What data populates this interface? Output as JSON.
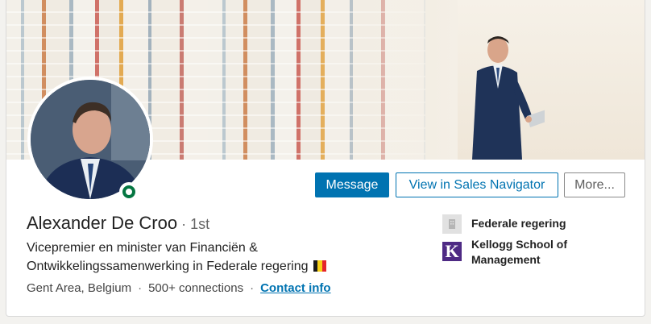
{
  "profile": {
    "name": "Alexander De Croo",
    "degree": " · 1st",
    "headline_line1": "Vicepremier en minister van Financiën &",
    "headline_line2": "Ontwikkelingssamenwerking in Federale regering",
    "location": "Gent Area, Belgium",
    "connections": "500+ connections",
    "contact_link": "Contact info",
    "separator": "·"
  },
  "actions": {
    "message": "Message",
    "sales_navigator": "View in Sales Navigator",
    "more": "More..."
  },
  "sidebar": {
    "company": "Federale regering",
    "school_line1": "Kellogg School of",
    "school_line2": "Management",
    "school_logo_letter": "K"
  },
  "icons": [
    "building-icon",
    "kellogg-logo",
    "belgium-flag-icon",
    "online-status-icon"
  ],
  "colors": {
    "primary": "#0073b1",
    "online": "#057642",
    "kellogg_purple": "#4e2a84"
  }
}
